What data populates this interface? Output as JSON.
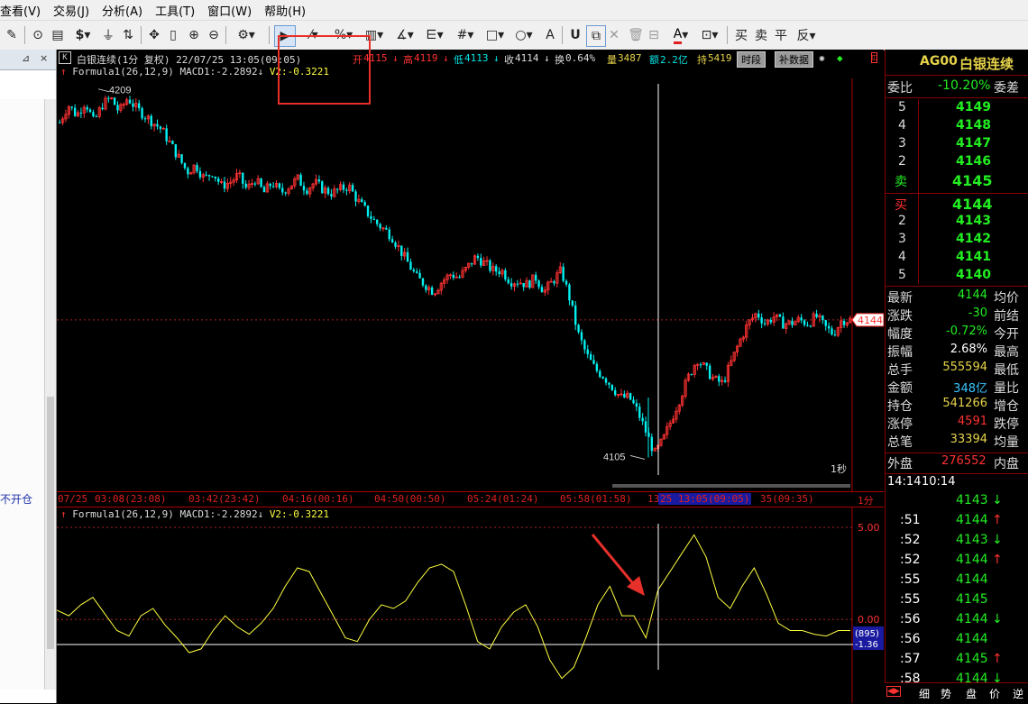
{
  "menu": [
    "查看(V)",
    "交易(J)",
    "分析(A)",
    "工具(T)",
    "窗口(W)",
    "帮助(H)"
  ],
  "sidebar": {
    "pin": "⊿",
    "close": "×",
    "status": "不开仓"
  },
  "chart": {
    "badge": "K",
    "title": "白银连续(1分 复权) 22/07/25 13:05(09:05)",
    "open_label": "开",
    "open": "4115",
    "high_label": "高",
    "high": "4119",
    "low_label": "低",
    "low": "4113",
    "close_label": "收",
    "close": "4114",
    "turnover_label": "换",
    "turnover": "0.64%",
    "volume_label": "量",
    "volume": "3487",
    "amount_label": "额",
    "amount": "2.2亿",
    "hold_label": "持",
    "hold": "5419",
    "btn_period": "时段",
    "btn_fill": "补数据",
    "formula_name": "Formula1(26,12,9)",
    "macd1": "MACD1:-2.2892",
    "v2": "V2:-0.3221",
    "price_high_label": "4209",
    "price_low_label": "4105",
    "current_price_tag": "4144",
    "interval": "1秒",
    "ind_max": "5.00",
    "ind_zero": "0.00",
    "ind_cursor": "(895)",
    "ind_current": "-1.36",
    "time_axis": [
      "07/25",
      "03:08(23:08)",
      "03:42(23:42)",
      "04:16(00:16)",
      "04:50(00:50)",
      "05:24(01:24)",
      "05:58(01:58)",
      "13",
      "25",
      "13:05(09:05)",
      "35(09:35)"
    ],
    "period": "1分"
  },
  "chart_data": [
    {
      "type": "candlestick",
      "title": "白银连续(1分 复权) 22/07/25 13:05(09:05)",
      "ylim": [
        4100,
        4212
      ],
      "annotations": {
        "high": 4209,
        "low": 4105,
        "current": 4144
      },
      "close_path": [
        4200,
        4205,
        4202,
        4206,
        4200,
        4205,
        4207,
        4203,
        4207,
        4204,
        4202,
        4200,
        4198,
        4194,
        4190,
        4186,
        4188,
        4184,
        4186,
        4182,
        4183,
        4185,
        4181,
        4184,
        4180,
        4183,
        4180,
        4182,
        4184,
        4181,
        4183,
        4181,
        4180,
        4181,
        4182,
        4178,
        4175,
        4172,
        4170,
        4168,
        4164,
        4160,
        4156,
        4154,
        4152,
        4155,
        4157,
        4156,
        4159,
        4162,
        4160,
        4158,
        4158,
        4155,
        4155,
        4154,
        4156,
        4152,
        4155,
        4158,
        4150,
        4140,
        4134,
        4130,
        4128,
        4125,
        4122,
        4122,
        4118,
        4112,
        4106,
        4110,
        4116,
        4122,
        4128,
        4133,
        4130,
        4127,
        4126,
        4132,
        4138,
        4143,
        4146,
        4143,
        4145,
        4143,
        4143,
        4144,
        4143,
        4145,
        4142,
        4140,
        4144,
        4144
      ]
    },
    {
      "type": "line",
      "series": [
        {
          "name": "V2",
          "values": [
            0.5,
            0.2,
            0.8,
            1.2,
            0.3,
            -0.6,
            -0.9,
            0.2,
            0.6,
            -0.3,
            -1.0,
            -1.8,
            -1.6,
            -0.6,
            0.2,
            -0.4,
            -0.8,
            -0.2,
            0.6,
            1.8,
            2.8,
            2.6,
            1.4,
            0.2,
            -1.0,
            -1.2,
            0.0,
            0.8,
            0.6,
            1.0,
            2.0,
            2.8,
            3.0,
            2.6,
            0.8,
            -1.2,
            -1.6,
            -0.4,
            0.4,
            0.8,
            -0.4,
            -2.2,
            -3.2,
            -2.6,
            -1.0,
            0.8,
            1.8,
            0.2,
            0.2,
            -1.0,
            1.6,
            2.6,
            3.6,
            4.6,
            3.4,
            1.2,
            0.6,
            1.8,
            2.8,
            1.4,
            -0.2,
            -0.6,
            -0.6,
            -0.8,
            -0.9,
            -0.6,
            -0.6
          ]
        }
      ],
      "ylim": [
        -4.2,
        5.2
      ],
      "annotations": {
        "max": 5.0,
        "zero": 0.0,
        "current": -1.36
      }
    }
  ],
  "quote": {
    "symbol": "AG00",
    "name": "白银连续",
    "ratio_label": "委比",
    "ratio": "-10.20%",
    "diff_label": "委差",
    "asks": [
      {
        "level": "5",
        "price": "4149"
      },
      {
        "level": "4",
        "price": "4148"
      },
      {
        "level": "3",
        "price": "4147"
      },
      {
        "level": "2",
        "price": "4146"
      }
    ],
    "sell_label": "卖",
    "sell_price": "4145",
    "buy_label": "买",
    "buy_price": "4144",
    "bids": [
      {
        "level": "2",
        "price": "4143"
      },
      {
        "level": "3",
        "price": "4142"
      },
      {
        "level": "4",
        "price": "4141"
      },
      {
        "level": "5",
        "price": "4140"
      }
    ],
    "stats": [
      {
        "l": "最新",
        "v": "4144",
        "c": "#22ee22",
        "r": "均价"
      },
      {
        "l": "涨跌",
        "v": "-30",
        "c": "#22ee22",
        "r": "前结"
      },
      {
        "l": "幅度",
        "v": "-0.72%",
        "c": "#22ee22",
        "r": "今开"
      },
      {
        "l": "振幅",
        "v": "2.68%",
        "c": "#ffffff",
        "r": "最高"
      },
      {
        "l": "总手",
        "v": "555594",
        "c": "#e6d34a",
        "r": "最低"
      },
      {
        "l": "金额",
        "v": "348亿",
        "c": "#39c6ff",
        "r": "量比"
      },
      {
        "l": "持仓",
        "v": "541266",
        "c": "#e6d34a",
        "r": "增仓"
      },
      {
        "l": "涨停",
        "v": "4591",
        "c": "#ff3030",
        "r": "跌停"
      },
      {
        "l": "总笔",
        "v": "33394",
        "c": "#e6d34a",
        "r": "均量"
      }
    ],
    "outer_label": "外盘",
    "outer": "276552",
    "inner_label": "内盘",
    "ticks_header": "14:14",
    "ticks_header2": "10:14",
    "ticks": [
      {
        "t": "",
        "p": "4143",
        "a": "↓",
        "ac": "#22ee22"
      },
      {
        "t": ":51",
        "p": "4144",
        "a": "↑",
        "ac": "#ff3030"
      },
      {
        "t": ":52",
        "p": "4143",
        "a": "↓",
        "ac": "#22ee22"
      },
      {
        "t": ":52",
        "p": "4144",
        "a": "↑",
        "ac": "#ff3030"
      },
      {
        "t": ":55",
        "p": "4144",
        "a": "",
        "ac": ""
      },
      {
        "t": ":55",
        "p": "4145",
        "a": "",
        "ac": ""
      },
      {
        "t": ":56",
        "p": "4144",
        "a": "↓",
        "ac": "#22ee22"
      },
      {
        "t": ":56",
        "p": "4144",
        "a": "",
        "ac": ""
      },
      {
        "t": ":57",
        "p": "4145",
        "a": "↑",
        "ac": "#ff3030"
      },
      {
        "t": ":58",
        "p": "4144",
        "a": "↓",
        "ac": "#22ee22"
      }
    ],
    "tabs": [
      "细",
      "势",
      "盘",
      "价",
      "逆"
    ]
  },
  "colors": {
    "up": "#ff3232",
    "down": "#00f0f0",
    "line": "#ffff40",
    "panel_border": "#880000",
    "green": "#22ee22"
  }
}
